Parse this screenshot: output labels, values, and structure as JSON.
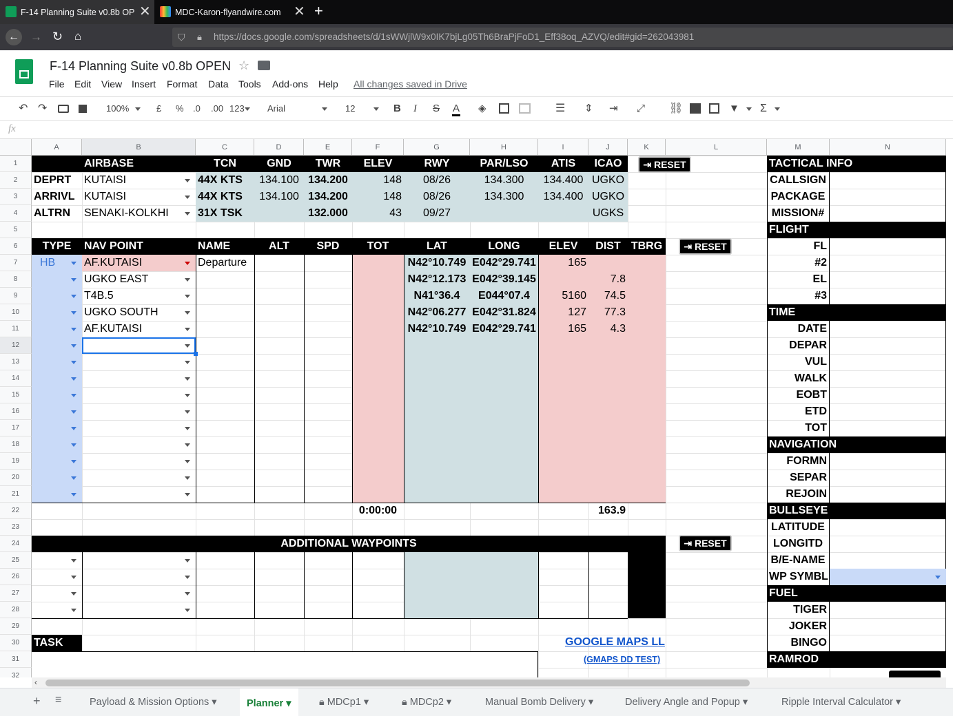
{
  "browser": {
    "tabs": [
      {
        "title": "F-14 Planning Suite v0.8b OPEN",
        "close": "✕"
      },
      {
        "title": "MDC-Karon-flyandwire.com",
        "close": "✕"
      }
    ],
    "new_tab": "+",
    "url": "https://docs.google.com/spreadsheets/d/1sWWjlW9x0IK7bjLg05Th6BraPjFoD1_Eff38oq_AZVQ/edit#gid=262043981"
  },
  "doc": {
    "title": "F-14 Planning Suite v0.8b OPEN",
    "menu": [
      "File",
      "Edit",
      "View",
      "Insert",
      "Format",
      "Data",
      "Tools",
      "Add-ons",
      "Help"
    ],
    "saved_status": "All changes saved in Drive"
  },
  "toolbar": {
    "zoom": "100%",
    "currency": "£",
    "percent": "%",
    "dec_less": ".0",
    "dec_more": ".00",
    "format_more": "123",
    "font": "Arial",
    "font_size": "12",
    "bold": "B",
    "italic": "I",
    "strike": "S",
    "text_color": "A",
    "functions": "Σ"
  },
  "formula_bar": {
    "fx": "fx",
    "value": ""
  },
  "columns": [
    "A",
    "B",
    "C",
    "D",
    "E",
    "F",
    "G",
    "H",
    "I",
    "J",
    "K",
    "L",
    "M",
    "N"
  ],
  "rows": [
    "1",
    "2",
    "3",
    "4",
    "5",
    "6",
    "7",
    "8",
    "9",
    "10",
    "11",
    "12",
    "13",
    "14",
    "15",
    "16",
    "17",
    "18",
    "19",
    "20",
    "21",
    "22",
    "23",
    "24",
    "25",
    "26",
    "27",
    "28",
    "29",
    "30",
    "31",
    "32"
  ],
  "airbase_table": {
    "headers": [
      "AIRBASE",
      "TCN",
      "GND",
      "TWR",
      "ELEV",
      "RWY",
      "PAR/LSO",
      "ATIS",
      "ICAO"
    ],
    "rows": [
      {
        "label": "DEPRT",
        "airbase": "KUTAISI",
        "tcn": "44X KTS",
        "gnd": "134.100",
        "twr": "134.200",
        "elev": "148",
        "rwy": "08/26",
        "par": "134.300",
        "atis": "134.400",
        "icao": "UGKO"
      },
      {
        "label": "ARRIVL",
        "airbase": "KUTAISI",
        "tcn": "44X KTS",
        "gnd": "134.100",
        "twr": "134.200",
        "elev": "148",
        "rwy": "08/26",
        "par": "134.300",
        "atis": "134.400",
        "icao": "UGKO"
      },
      {
        "label": "ALTRN",
        "airbase": "SENAKI-KOLKHI",
        "tcn": "31X TSK",
        "gnd": "",
        "twr": "132.000",
        "elev": "43",
        "rwy": "09/27",
        "par": "",
        "atis": "",
        "icao": "UGKS"
      }
    ]
  },
  "reset_label": "⇥ RESET",
  "nav_table": {
    "headers": [
      "TYPE",
      "NAV POINT",
      "NAME",
      "ALT",
      "SPD",
      "TOT",
      "LAT",
      "LONG",
      "ELEV",
      "DIST",
      "TBRG"
    ],
    "rows": [
      {
        "type": "HB",
        "point": "AF.KUTAISI",
        "name": "Departure",
        "lat": "N42°10.749",
        "long": "E042°29.741",
        "elev": "165",
        "dist": ""
      },
      {
        "type": "",
        "point": "UGKO EAST",
        "name": "",
        "lat": "N42°12.173",
        "long": "E042°39.145",
        "elev": "",
        "dist": "7.8"
      },
      {
        "type": "",
        "point": "T4B.5",
        "name": "",
        "lat": "N41°36.4",
        "long": "E044°07.4",
        "elev": "5160",
        "dist": "74.5"
      },
      {
        "type": "",
        "point": "UGKO SOUTH",
        "name": "",
        "lat": "N42°06.277",
        "long": "E042°31.824",
        "elev": "127",
        "dist": "77.3"
      },
      {
        "type": "",
        "point": "AF.KUTAISI",
        "name": "",
        "lat": "N42°10.749",
        "long": "E042°29.741",
        "elev": "165",
        "dist": "4.3"
      }
    ],
    "total_tot": "0:00:00",
    "total_dist": "163.9"
  },
  "additional_waypoints": "ADDITIONAL WAYPOINTS",
  "task_label": "TASK",
  "links": {
    "google_maps": "GOOGLE MAPS LL",
    "gmaps_test": "(GMAPS DD TEST)"
  },
  "side_panel": [
    {
      "label": "TACTICAL INFO",
      "header": true
    },
    {
      "label": "CALLSIGN"
    },
    {
      "label": "PACKAGE"
    },
    {
      "label": "MISSION#"
    },
    {
      "label": "FLIGHT",
      "header": true
    },
    {
      "label": "FL",
      "right": true
    },
    {
      "label": "#2",
      "right": true
    },
    {
      "label": "EL",
      "right": true
    },
    {
      "label": "#3",
      "right": true
    },
    {
      "label": "TIME",
      "header": true
    },
    {
      "label": "DATE",
      "right": true
    },
    {
      "label": "DEPAR",
      "right": true
    },
    {
      "label": "VUL",
      "right": true
    },
    {
      "label": "WALK",
      "right": true
    },
    {
      "label": "EOBT",
      "right": true
    },
    {
      "label": "ETD",
      "right": true
    },
    {
      "label": "TOT",
      "right": true
    },
    {
      "label": "NAVIGATION",
      "header": true
    },
    {
      "label": "FORMN",
      "right": true
    },
    {
      "label": "SEPAR",
      "right": true
    },
    {
      "label": "REJOIN",
      "right": true
    },
    {
      "label": "BULLSEYE",
      "header": true
    },
    {
      "label": "LATITUDE"
    },
    {
      "label": "LONGITD"
    },
    {
      "label": "B/E-NAME"
    },
    {
      "label": "WP SYMBL",
      "blue": true
    },
    {
      "label": "FUEL",
      "header": true
    },
    {
      "label": "TIGER",
      "right": true
    },
    {
      "label": "JOKER",
      "right": true
    },
    {
      "label": "BINGO",
      "right": true
    },
    {
      "label": "RAMROD",
      "header": true
    }
  ],
  "sheet_tabs": [
    "Payload & Mission Options",
    "Planner",
    "MDCp1",
    "MDCp2",
    "Manual Bomb Delivery",
    "Delivery Angle and Popup",
    "Ripple Interval Calculator"
  ],
  "active_sheet": "Planner",
  "colors": {
    "pink": "#f4cccc",
    "teal": "#d0e0e3",
    "blue": "#c9daf8",
    "green": "#0f9d58",
    "accent": "#188038"
  }
}
